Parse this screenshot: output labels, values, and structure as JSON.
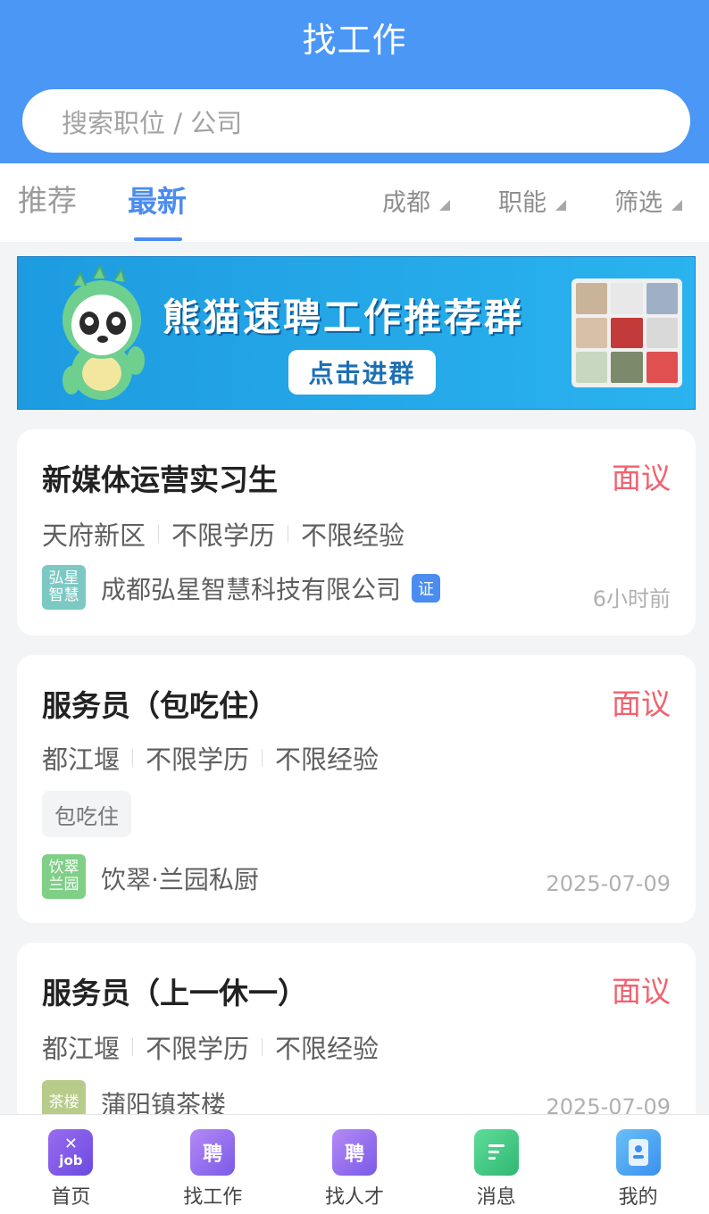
{
  "header": {
    "title": "找工作",
    "search_placeholder": "搜索职位 / 公司"
  },
  "tabs": {
    "recommend": "推荐",
    "latest": "最新"
  },
  "filters": {
    "city": "成都",
    "function": "职能",
    "screen": "筛选"
  },
  "banner": {
    "title": "熊猫速聘工作推荐群",
    "button": "点击进群"
  },
  "jobs": [
    {
      "title": "新媒体运营实习生",
      "salary": "面议",
      "location": "天府新区",
      "education": "不限学历",
      "experience": "不限经验",
      "logo_text": "弘星智慧",
      "company": "成都弘星智慧科技有限公司",
      "verified": "证",
      "time": "6小时前"
    },
    {
      "title": "服务员（包吃住）",
      "salary": "面议",
      "location": "都江堰",
      "education": "不限学历",
      "experience": "不限经验",
      "tag": "包吃住",
      "logo_text": "饮翠兰园",
      "company": "饮翠·兰园私厨",
      "time": "2025-07-09"
    },
    {
      "title": "服务员（上一休一）",
      "salary": "面议",
      "location": "都江堰",
      "education": "不限学历",
      "experience": "不限经验",
      "logo_text": "茶楼",
      "company": "蒲阳镇茶楼",
      "time": "2025-07-09"
    }
  ],
  "nav": [
    {
      "label": "首页",
      "icon": "job"
    },
    {
      "label": "找工作",
      "icon": "聘"
    },
    {
      "label": "找人才",
      "icon": "聘"
    },
    {
      "label": "消息",
      "icon": "message-icon"
    },
    {
      "label": "我的",
      "icon": "profile-icon"
    }
  ],
  "colors": {
    "primary": "#4a97f5",
    "accent": "#4a8cf0",
    "salary": "#f0626f"
  }
}
